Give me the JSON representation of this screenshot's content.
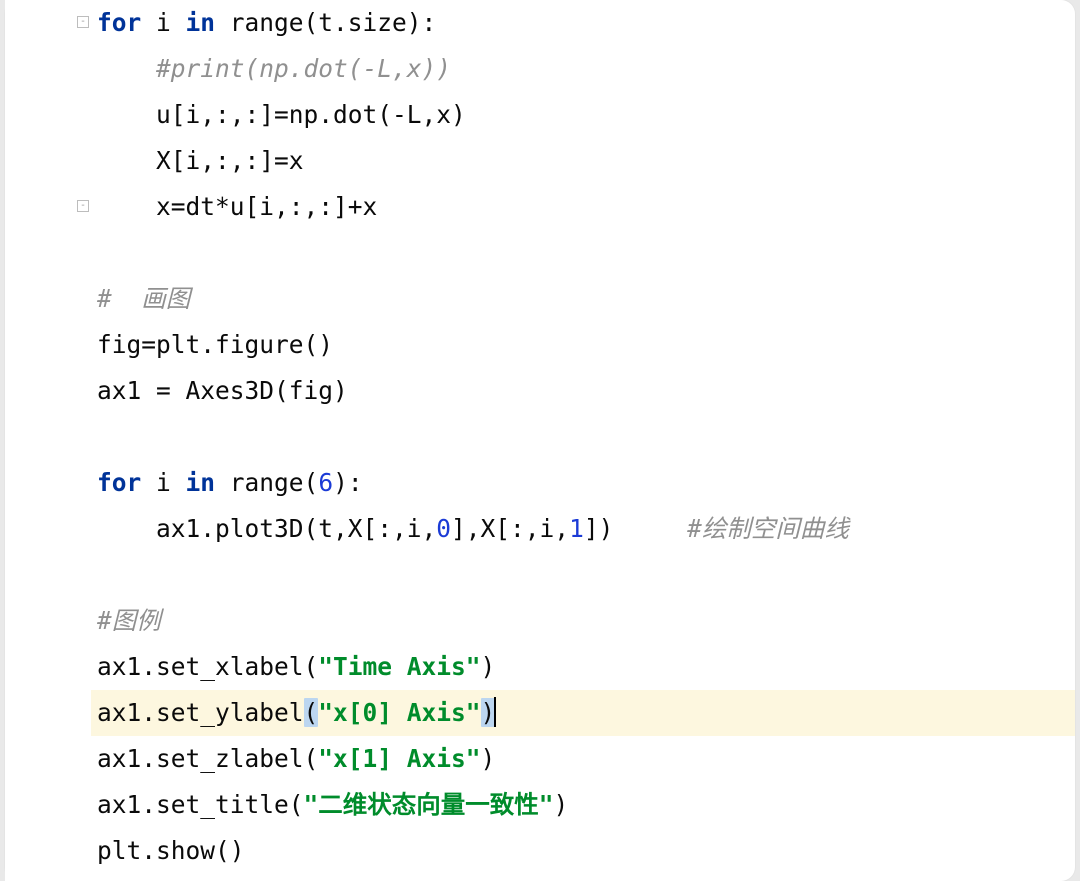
{
  "lineHeight": 46,
  "highlightedLine": 13,
  "foldMarkers": [
    {
      "line": 0,
      "glyph": "-"
    },
    {
      "line": 4,
      "glyph": "-"
    }
  ],
  "code": [
    {
      "indent": 0,
      "tokens": [
        {
          "t": "for ",
          "c": "kw"
        },
        {
          "t": "i "
        },
        {
          "t": "in ",
          "c": "kw"
        },
        {
          "t": "range(t.size):",
          "c": "call"
        }
      ]
    },
    {
      "indent": 1,
      "tokens": [
        {
          "t": "#print(np.dot(-L,x))",
          "c": "comment"
        }
      ]
    },
    {
      "indent": 1,
      "tokens": [
        {
          "t": "u[i,:,:]=np.dot(-L,x)"
        }
      ]
    },
    {
      "indent": 1,
      "tokens": [
        {
          "t": "X[i,:,:]=x"
        }
      ]
    },
    {
      "indent": 1,
      "tokens": [
        {
          "t": "x=dt*u[i,:,:]+x"
        }
      ]
    },
    {
      "indent": 0,
      "tokens": []
    },
    {
      "indent": 0,
      "tokens": [
        {
          "t": "#  画图",
          "c": "comment"
        }
      ]
    },
    {
      "indent": 0,
      "tokens": [
        {
          "t": "fig=plt.figure()"
        }
      ]
    },
    {
      "indent": 0,
      "tokens": [
        {
          "t": "ax1 = Axes3D(fig)"
        }
      ]
    },
    {
      "indent": 0,
      "tokens": []
    },
    {
      "indent": 0,
      "tokens": [
        {
          "t": "for ",
          "c": "kw"
        },
        {
          "t": "i "
        },
        {
          "t": "in ",
          "c": "kw"
        },
        {
          "t": "range(",
          "c": "call"
        },
        {
          "t": "6",
          "c": "num"
        },
        {
          "t": "):"
        }
      ]
    },
    {
      "indent": 1,
      "tokens": [
        {
          "t": "ax1.plot3D(t,X[:,i,"
        },
        {
          "t": "0",
          "c": "num"
        },
        {
          "t": "],X[:,i,"
        },
        {
          "t": "1",
          "c": "num"
        },
        {
          "t": "])"
        },
        {
          "t": "     "
        },
        {
          "t": "#绘制空间曲线",
          "c": "comment"
        }
      ]
    },
    {
      "indent": 0,
      "tokens": []
    },
    {
      "indent": 0,
      "tokens": [
        {
          "t": "#图例",
          "c": "comment"
        }
      ]
    },
    {
      "indent": 0,
      "tokens": [
        {
          "t": "ax1.set_xlabel("
        },
        {
          "t": "\"Time Axis\"",
          "c": "str"
        },
        {
          "t": ")"
        }
      ]
    },
    {
      "indent": 0,
      "highlighted": true,
      "caretAfter": true,
      "tokens": [
        {
          "t": "ax1.set_ylabel"
        },
        {
          "t": "(",
          "sel": true
        },
        {
          "t": "\"x[0] Axis\"",
          "c": "str"
        },
        {
          "t": ")",
          "sel": true
        }
      ]
    },
    {
      "indent": 0,
      "tokens": [
        {
          "t": "ax1.set_zlabel("
        },
        {
          "t": "\"x[1] Axis\"",
          "c": "str"
        },
        {
          "t": ")"
        }
      ]
    },
    {
      "indent": 0,
      "tokens": [
        {
          "t": "ax1.set_title("
        },
        {
          "t": "\"二维状态向量一致性\"",
          "c": "str"
        },
        {
          "t": ")"
        }
      ]
    },
    {
      "indent": 0,
      "tokens": [
        {
          "t": "plt.show()"
        }
      ]
    }
  ]
}
